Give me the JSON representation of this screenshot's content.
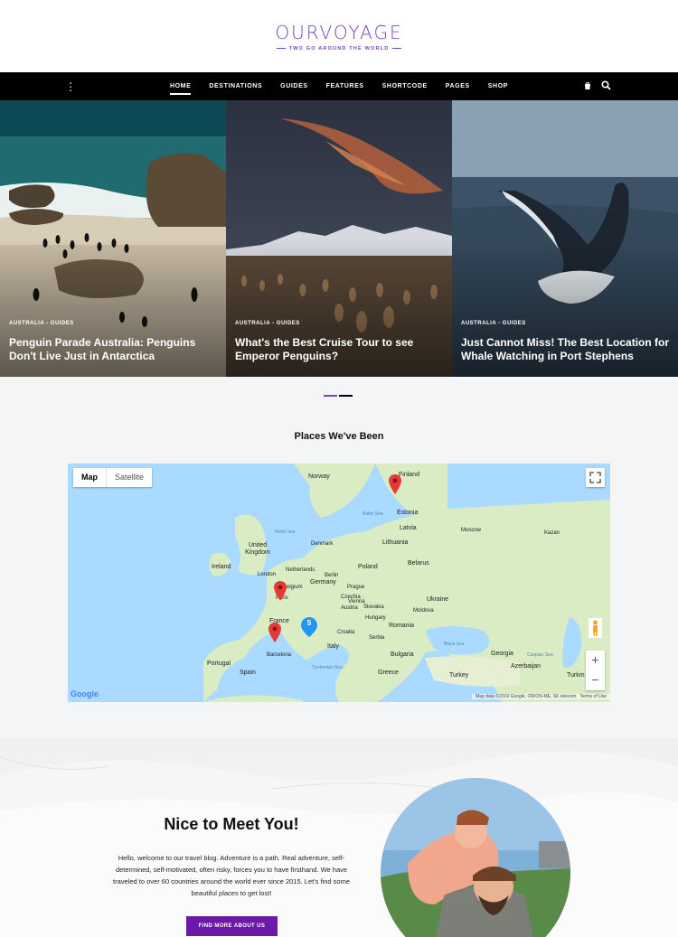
{
  "brand": {
    "name": "OURVOYAGE",
    "tagline": "TWO GO AROUND THE WORLD"
  },
  "nav": {
    "items": [
      {
        "label": "HOME",
        "active": true
      },
      {
        "label": "DESTINATIONS",
        "active": false
      },
      {
        "label": "GUIDES",
        "active": false
      },
      {
        "label": "FEATURES",
        "active": false
      },
      {
        "label": "SHORTCODE",
        "active": false
      },
      {
        "label": "PAGES",
        "active": false
      },
      {
        "label": "SHOP",
        "active": false
      }
    ],
    "icons": {
      "menu": "vertical-dots-icon",
      "cart": "cart-icon",
      "search": "search-icon"
    }
  },
  "slides": [
    {
      "category": "AUSTRALIA - GUIDES",
      "title": "Penguin Parade Australia: Penguins Don't Live Just in Antarctica"
    },
    {
      "category": "AUSTRALIA - GUIDES",
      "title": "What's the Best Cruise Tour to see Emperor Penguins?"
    },
    {
      "category": "AUSTRALIA - GUIDES",
      "title": "Just Cannot Miss! The Best Location for Whale Watching in Port Stephens"
    }
  ],
  "slider_pagination": {
    "total": 2,
    "active": 0
  },
  "places": {
    "title": "Places We've Been",
    "map_types": [
      "Map",
      "Satellite"
    ],
    "active_map_type": "Map",
    "zoom_in": "+",
    "zoom_out": "−",
    "cluster_count": "5",
    "countries": [
      "Norway",
      "Finland",
      "Estonia",
      "Latvia",
      "Lithuania",
      "United Kingdom",
      "Ireland",
      "Denmark",
      "Netherlands",
      "Belgium",
      "Germany",
      "Poland",
      "Belarus",
      "Czechia",
      "Slovakia",
      "Austria",
      "Hungary",
      "Ukraine",
      "France",
      "Romania",
      "Moldova",
      "Croatia",
      "Serbia",
      "Italy",
      "Portugal",
      "Spain",
      "Bulgaria",
      "Greece",
      "Turkey",
      "Georgia",
      "Azerbaijan",
      "Turkm"
    ],
    "cities": [
      "London",
      "Paris",
      "Berlin",
      "Prague",
      "Vienna",
      "Barcelona",
      "Moscow",
      "Kazan"
    ],
    "seas": [
      "North Sea",
      "Baltic Sea",
      "Black Sea",
      "Tyrrhenian Sea",
      "Caspian Sea"
    ],
    "logo": "Google",
    "attribution": "Map data ©2019 Google, ORION-ME, SK telecom",
    "terms": "Terms of Use",
    "colors": {
      "water": "#aadaff",
      "land": "#d9ecc4",
      "marker": "#e53935",
      "cluster": "#2196f3"
    }
  },
  "about": {
    "title": "Nice to Meet You!",
    "text": "Hello, welcome to our travel blog. Adventure is a path. Real adventure, self-determined, self-motivated, often risky, forces you to have firsthand. We have traveled to over 60 countries around the world ever since 2015. Let's find some beautiful places to get lost!",
    "button": "FIND MORE ABOUT US"
  },
  "colors": {
    "accent": "#7a3fc4",
    "nav_bg": "#000000",
    "button_bg": "#6a1aa6"
  }
}
